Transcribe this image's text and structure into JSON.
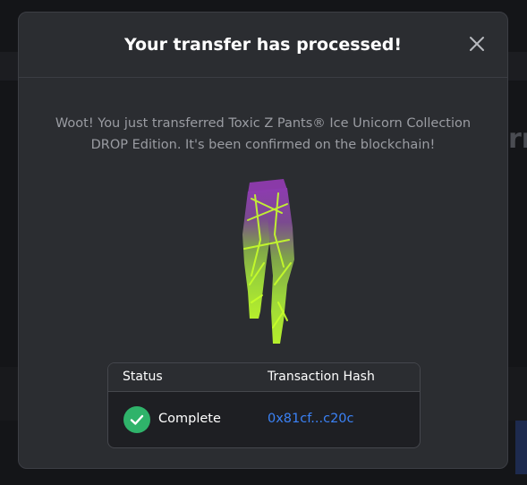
{
  "modal": {
    "title": "Your transfer has processed!",
    "message": "Woot! You just transferred Toxic Z Pants® Ice Unicorn Collection DROP Edition. It's been confirmed on the blockchain!",
    "close_icon": "close-icon",
    "item_image": "toxic-z-pants-image"
  },
  "table": {
    "headers": {
      "status": "Status",
      "hash": "Transaction Hash"
    },
    "row": {
      "status": "Complete",
      "status_icon": "check-circle-icon",
      "hash": "0x81cf...c20c"
    }
  },
  "colors": {
    "modal_bg": "#2b2d31",
    "success": "#2fb36a",
    "link": "#3b82f6",
    "pants_purple": "#8d3bb0",
    "pants_green": "#9be22d"
  }
}
